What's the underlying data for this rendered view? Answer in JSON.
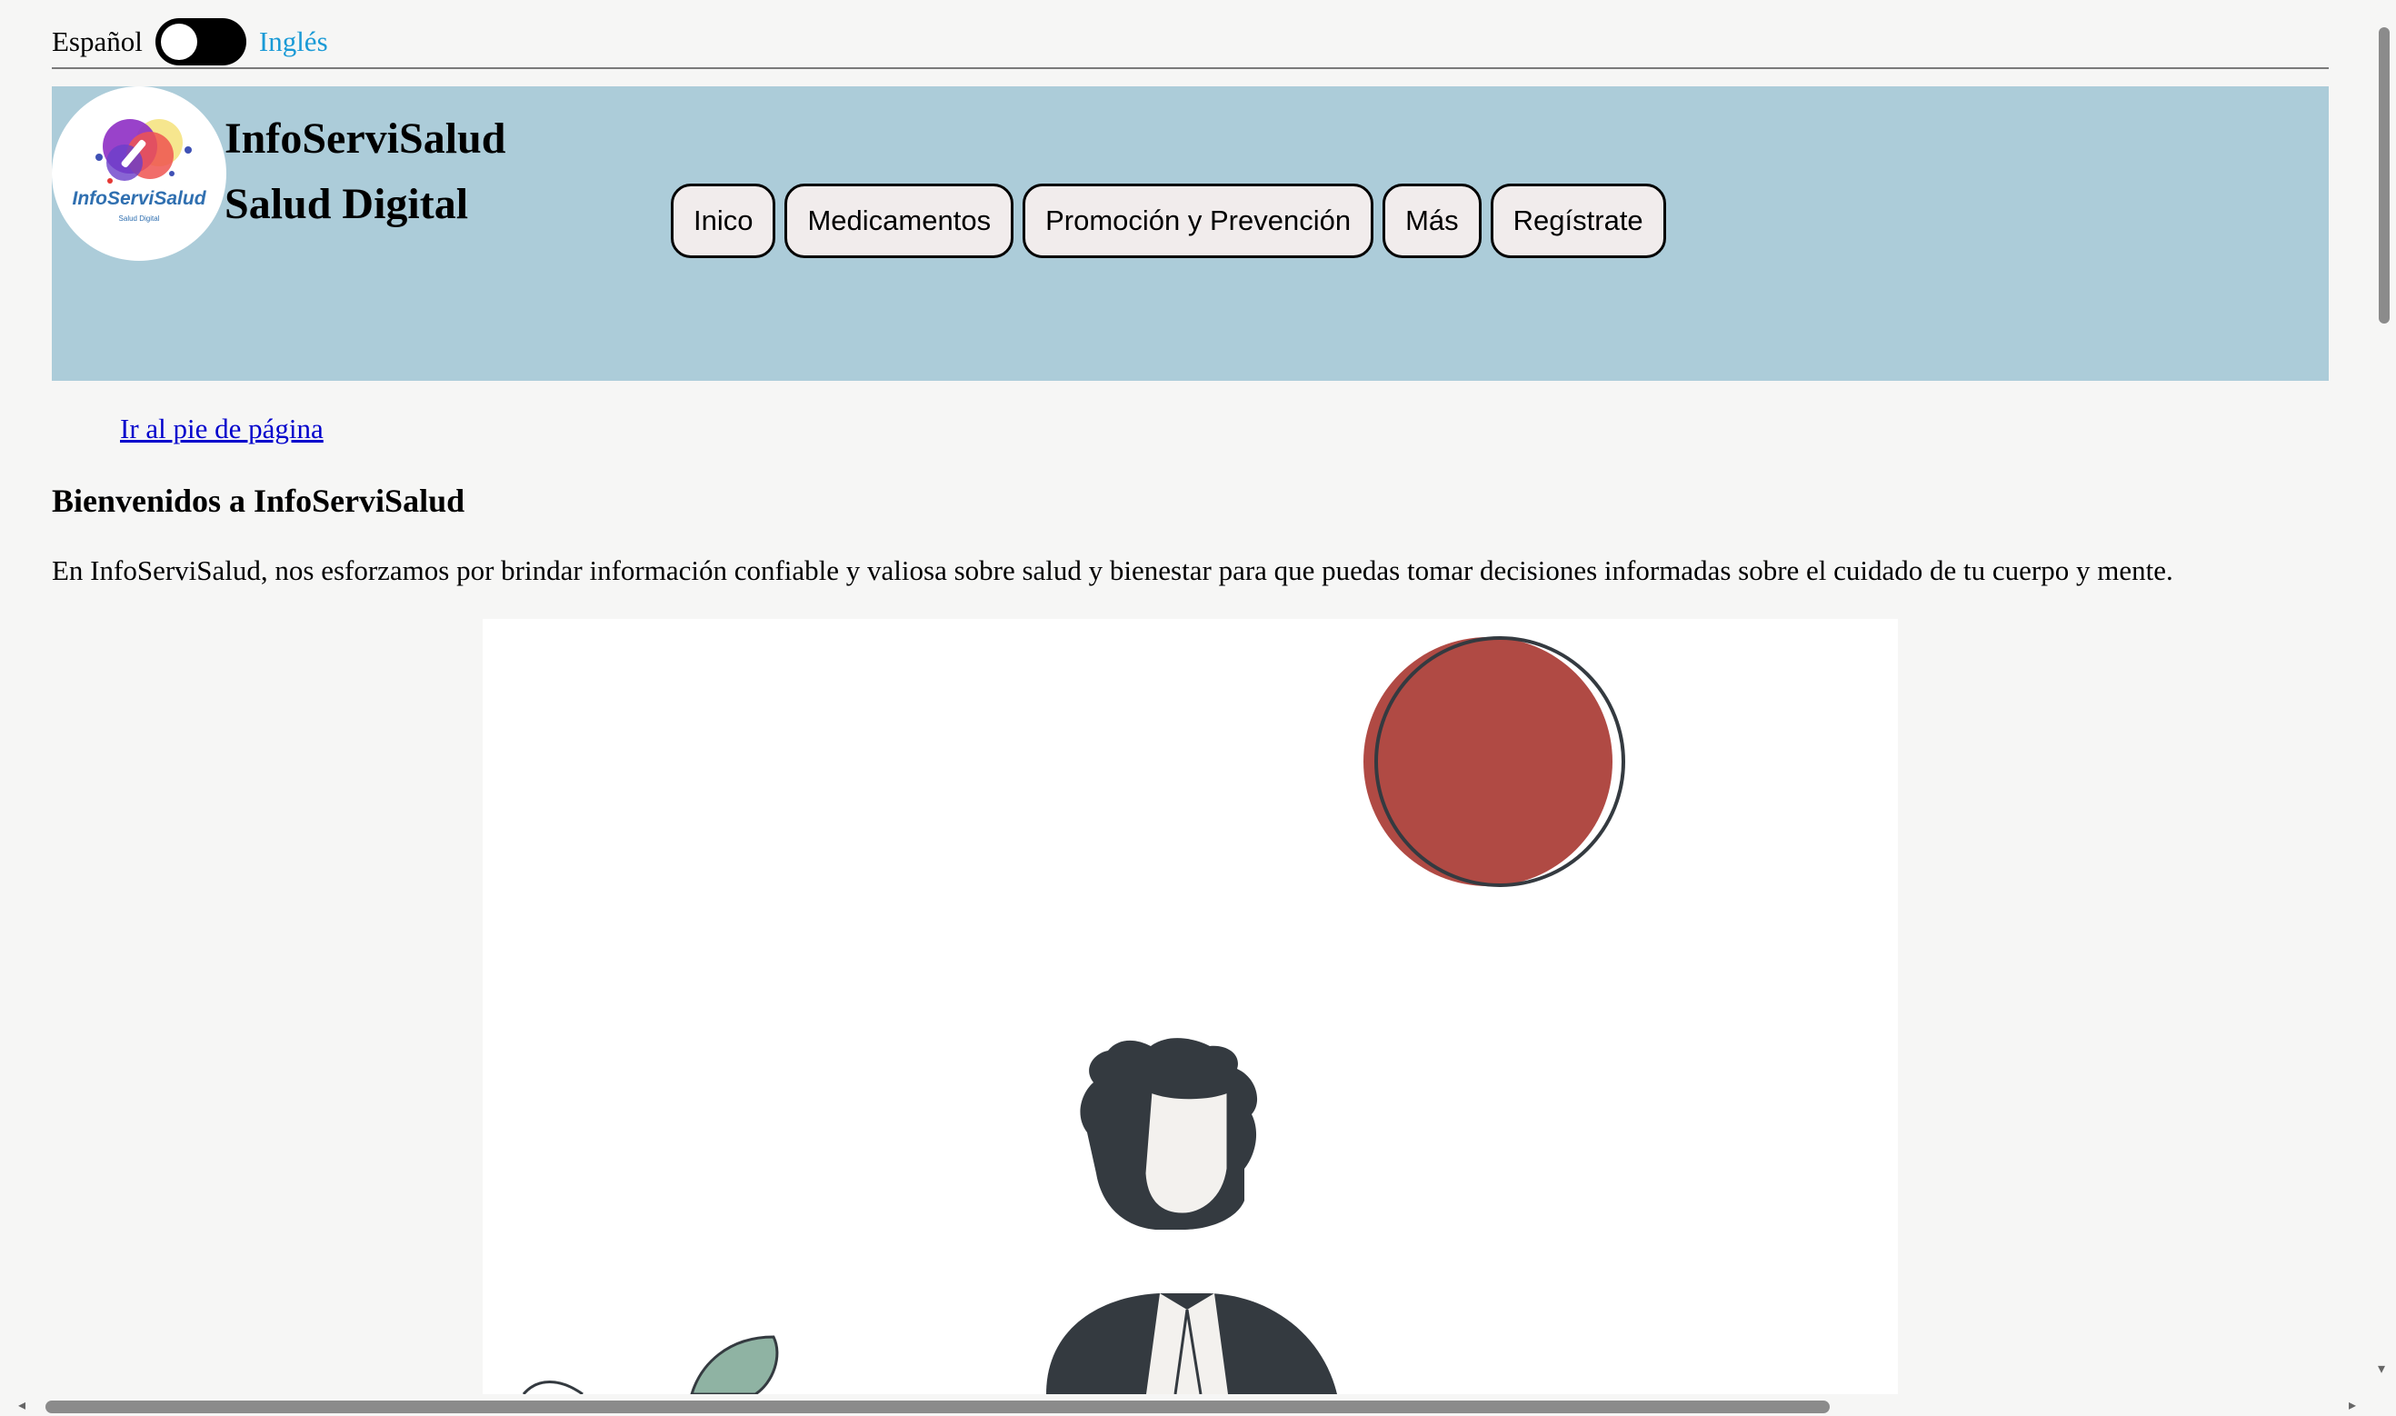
{
  "language": {
    "left_label": "Español",
    "right_label": "Inglés"
  },
  "header": {
    "logo_text": "InfoServiSalud",
    "logo_subtext": "Salud Digital",
    "title_line1": "InfoServiSalud",
    "title_line2": "Salud Digital",
    "nav": [
      "Inico",
      "Medicamentos",
      "Promoción y Prevención",
      "Más",
      "Regístrate"
    ]
  },
  "main": {
    "skip_link": "Ir al pie de página",
    "heading": "Bienvenidos a InfoServiSalud",
    "intro": "En InfoServiSalud, nos esforzamos por brindar información confiable y valiosa sobre salud y bienestar para que puedas tomar decisiones informadas sobre el cuidado de tu cuerpo y mente."
  },
  "colors": {
    "header_bg": "#acccd9",
    "accent_link": "#1a9ad6",
    "illustration_red": "#b04a44",
    "illustration_dark": "#343a40"
  }
}
